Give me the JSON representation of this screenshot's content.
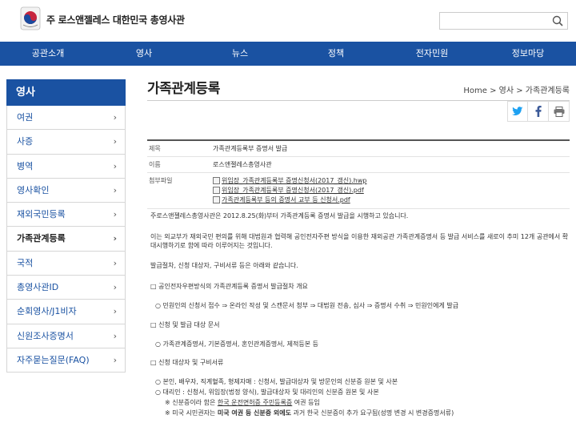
{
  "header": {
    "title": "주 로스앤젤레스 대한민국 총영사관",
    "search_placeholder": ""
  },
  "nav": [
    "공관소개",
    "영사",
    "뉴스",
    "정책",
    "전자민원",
    "정보마당"
  ],
  "sidebar": {
    "heading": "영사",
    "items": [
      {
        "label": "여권"
      },
      {
        "label": "사증"
      },
      {
        "label": "병역"
      },
      {
        "label": "영사확인"
      },
      {
        "label": "재외국민등록"
      },
      {
        "label": "가족관계등록"
      },
      {
        "label": "국적"
      },
      {
        "label": "총영사관ID"
      },
      {
        "label": "순회영사/J1비자"
      },
      {
        "label": "신원조사증명서"
      },
      {
        "label": "자주묻는질문(FAQ)"
      }
    ]
  },
  "page": {
    "title": "가족관계등록",
    "breadcrumb": "Home  >  영사  >  가족관계등록"
  },
  "meta": {
    "subject_label": "제목",
    "subject": "가족관계등록부 증명서 발급",
    "name_label": "이름",
    "name": "로스앤젤레스총영사관",
    "files_label": "첨부파일",
    "files": [
      "위임장_가족관계등록부 증명신청서(2017_갱신).hwp",
      "위임장_가족관계등록부 증명신청서(2017_갱신).pdf",
      "가족관계등록부 등의 증명서 교부 등 신청서.pdf"
    ]
  },
  "body": {
    "p1": "주로스앤젤레스총영사관은 2012.8.25(화)부터 가족관계등록 증명서 발급을 시행하고 있습니다.",
    "p2": "이는 외교부가 재외국민 편의를 위해 대법원과 협력해 공인전자주편 방식을 이용한 재외공관 가족관계증명서 등 발급 서비스를 새로이 추미 12개 공관에서 확대시행하기로 함에 따라 이루어지는 것입니다.",
    "p3": "발급절차, 신청 대상자, 구비서류 등은 아래와 같습니다.",
    "s1": "□ 공인전자우편방식의 가족관계등록 증명서 발급절차 개요",
    "s1a": "○ 민원인의 신청서 접수 ⇒ 온라인 작성 및 스캔문서 청부 ⇒ 대법원 전송, 심사 ⇒ 증명서 수취 ⇒ 민원인에게 발급",
    "s2": "□ 신청 및 발급 대상 문서",
    "s2a": "○ 가족관계증명서, 기본증명서, 혼인관계증명서, 제적등본 등",
    "s3": "□ 신청 대상자 및 구비서류",
    "s3a": "○ 본인, 배우자, 직계혈족, 형제자매 : 신청서, 발급대상자 및 방문인의 신분증 원본 및 사본",
    "s3b": "○ 대리인 : 신청서, 위임장(법정 양식), 발급대상자 및 대리인의 신분증 원본 및 사본",
    "n1_pre": "※ 신분증이라 함은 ",
    "n1_link": "한국 운전면허증 주민등록증",
    "n1_post": " 여권 등임",
    "n2_pre": "※ 미국 시민권자는 ",
    "n2_bold": "미국 여권 등 신분증 외에도",
    "n2_post": " 과거 한국 신분증이 추가 요구됨(성명 변경 시 변경증명서류)"
  }
}
